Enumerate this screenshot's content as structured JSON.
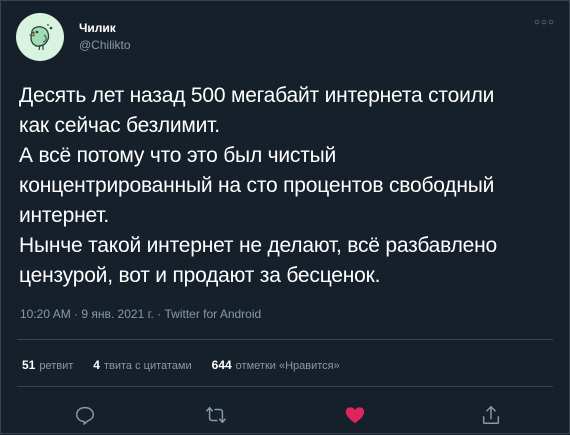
{
  "user": {
    "display_name": "Чилик",
    "handle": "@Chilikto"
  },
  "tweet": {
    "lines": [
      "Десять лет назад 500 мегабайт интернета стоили",
      "как сейчас безлимит.",
      "А всё потому что это был чистый",
      "концентрированный на сто процентов свободный",
      "интернет.",
      "Нынче такой интернет не делают, всё разбавлено",
      "цензурой, вот и продают за бесценок."
    ],
    "meta": "10:20 AM · 9 янв. 2021 г. · Twitter for Android"
  },
  "stats": {
    "retweets_count": "51",
    "retweets_label": "ретвит",
    "quotes_count": "4",
    "quotes_label": "твита с цитатами",
    "likes_count": "644",
    "likes_label": "отметки «Нравится»"
  },
  "icons": {
    "reply": "reply-icon",
    "retweet": "retweet-icon",
    "like": "heart-icon",
    "share": "share-icon",
    "more": "more-icon"
  },
  "colors": {
    "background": "#15202b",
    "muted": "#8899a6",
    "like": "#e0245e",
    "avatar_bg": "#d8f3df"
  }
}
